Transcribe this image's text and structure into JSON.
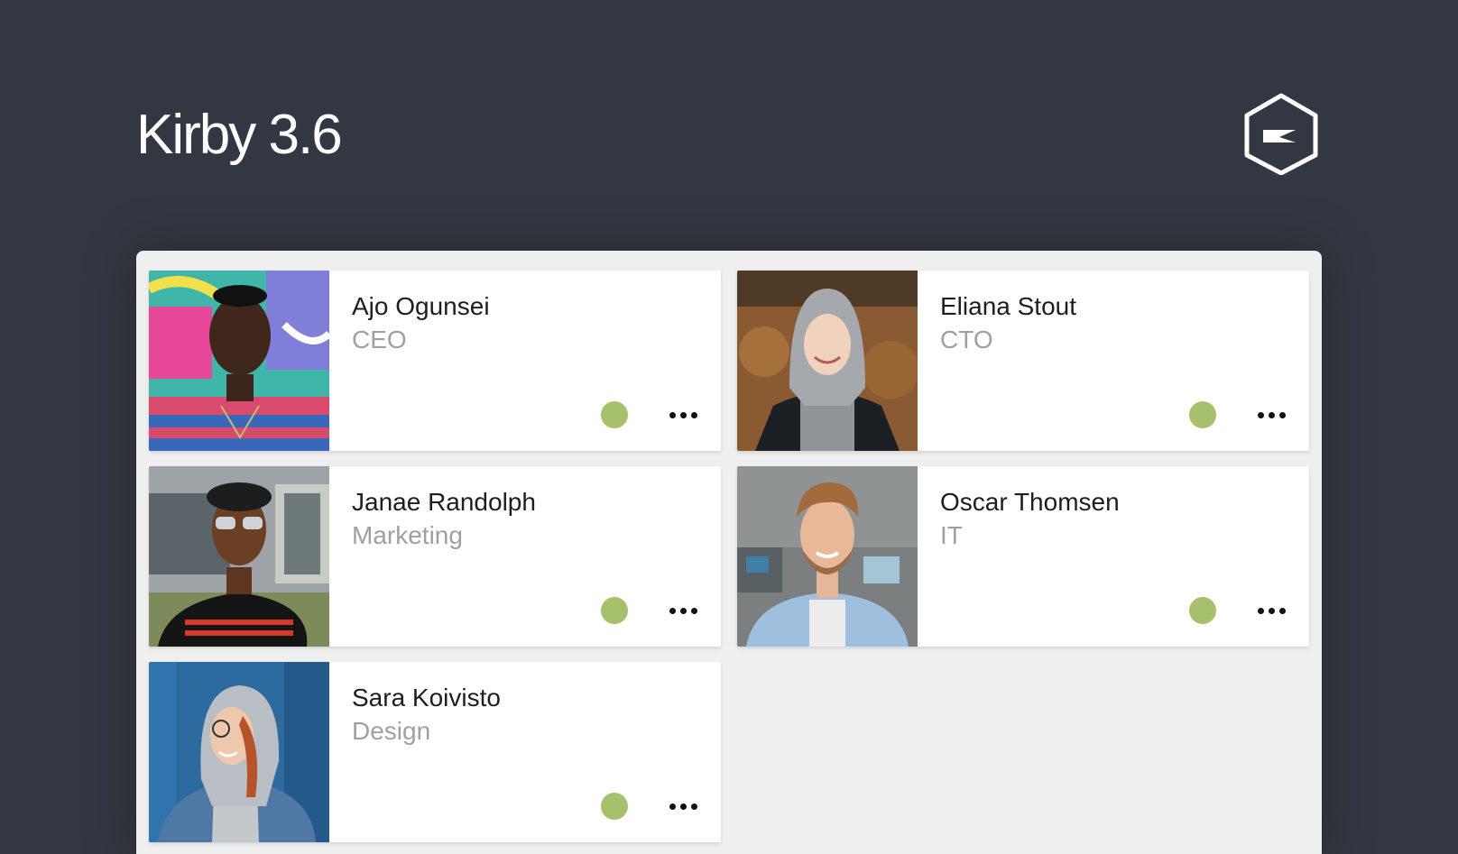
{
  "header": {
    "title": "Kirby 3.6",
    "logo_icon": "kirby-hexagon-logo"
  },
  "colors": {
    "background": "#323741",
    "panel": "#efefef",
    "card": "#ffffff",
    "status_active": "#a7c06c",
    "role_text": "#a0a0a0"
  },
  "users": [
    {
      "name": "Ajo Ogunsei",
      "role": "CEO",
      "status": "active"
    },
    {
      "name": "Eliana Stout",
      "role": "CTO",
      "status": "active"
    },
    {
      "name": "Janae Randolph",
      "role": "Marketing",
      "status": "active"
    },
    {
      "name": "Oscar Thomsen",
      "role": "IT",
      "status": "active"
    },
    {
      "name": "Sara Koivisto",
      "role": "Design",
      "status": "active"
    }
  ]
}
